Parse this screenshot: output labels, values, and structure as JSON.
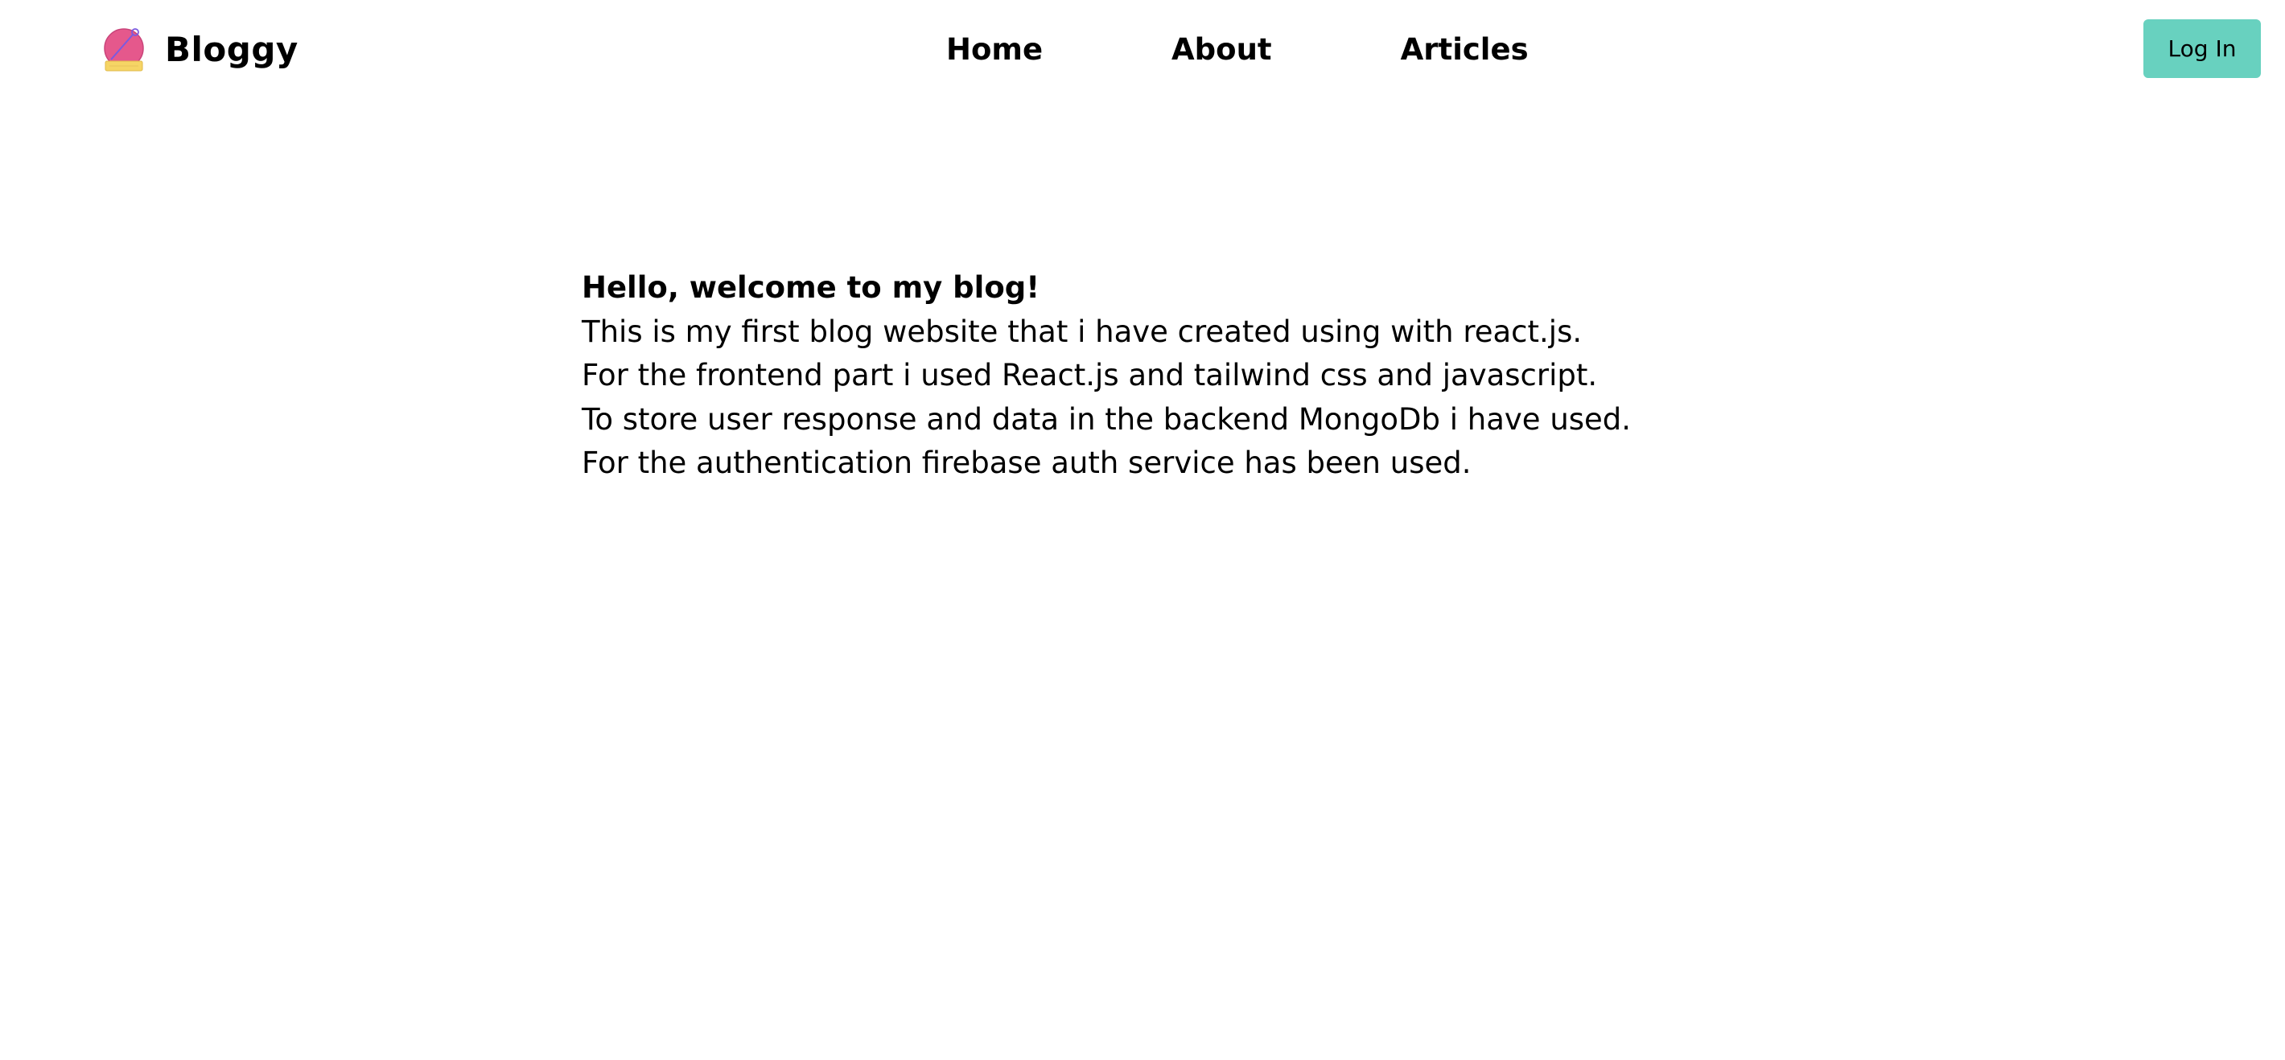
{
  "brand": {
    "name": "Bloggy",
    "logo_icon": "bloggy-logo-icon",
    "logo_colors": {
      "circle": "#e5588c",
      "base": "#f6d565",
      "accent": "#7a5ae0"
    }
  },
  "nav": {
    "links": [
      {
        "label": "Home"
      },
      {
        "label": "About"
      },
      {
        "label": "Articles"
      }
    ]
  },
  "auth": {
    "login_label": "Log In",
    "login_color": "#68d1bf"
  },
  "content": {
    "greeting": "Hello, welcome to my blog!",
    "lines": [
      "This is my first blog website that i have created using with react.js.",
      "For the frontend part i used React.js and tailwind css and javascript.",
      "To store user response and data in the backend MongoDb i have used.",
      "For the authentication firebase auth service has been used."
    ]
  }
}
